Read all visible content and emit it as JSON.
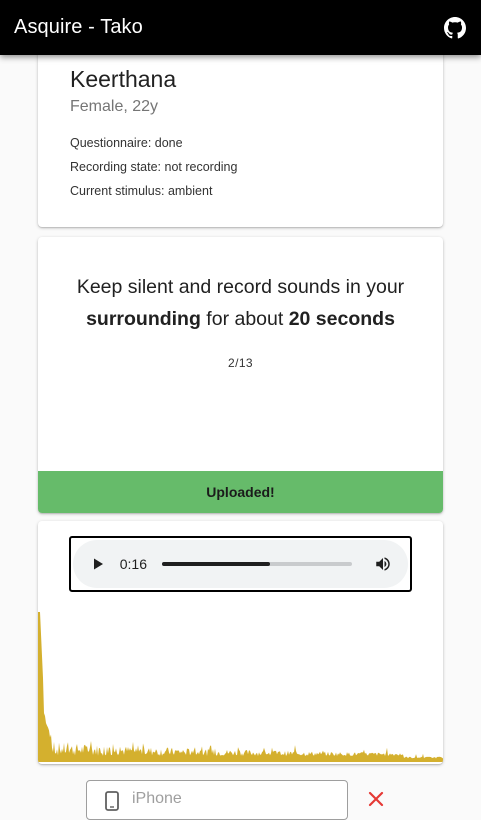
{
  "app": {
    "title": "Asquire - Tako",
    "github_icon": "github-icon"
  },
  "profile": {
    "name": "Keerthana",
    "subtitle": "Female, 22y",
    "questionnaire": "Questionnaire: done",
    "recording_state": "Recording state: not recording",
    "current_stimulus": "Current stimulus: ambient"
  },
  "task": {
    "instruction_part1": "Keep silent and record sounds in your",
    "instruction_bold1": "surrounding",
    "instruction_part2": " for about ",
    "instruction_bold2": "20 seconds",
    "progress": "2/13",
    "upload_status": "Uploaded!"
  },
  "audio": {
    "current_time": "0:16",
    "progress_fraction": 0.57,
    "play_icon": "play-icon",
    "volume_icon": "volume-icon",
    "waveform_color": "#d4b02e"
  },
  "device": {
    "placeholder": "iPhone",
    "icon": "phone-icon",
    "clear_icon": "close-icon",
    "clear_color": "#e53935"
  },
  "colors": {
    "appbar": "#000000",
    "success": "#66bb6a"
  }
}
